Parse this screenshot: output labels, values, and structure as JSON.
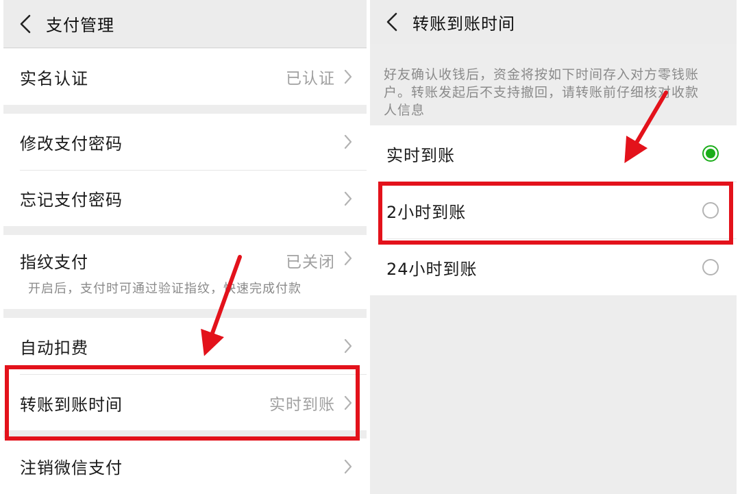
{
  "left": {
    "title": "支付管理",
    "rows": [
      {
        "label": "实名认证",
        "value": "已认证"
      },
      {
        "label": "修改支付密码",
        "value": ""
      },
      {
        "label": "忘记支付密码",
        "value": ""
      },
      {
        "label": "指纹支付",
        "value": "已关闭",
        "sub": "开启后，支付时可通过验证指纹，快速完成付款"
      },
      {
        "label": "自动扣费",
        "value": ""
      },
      {
        "label": "转账到账时间",
        "value": "实时到账"
      },
      {
        "label": "注销微信支付",
        "value": ""
      }
    ]
  },
  "right": {
    "title": "转账到账时间",
    "description": "好友确认收钱后，资金将按如下时间存入对方零钱账户。转账发起后不支持撤回，请转账前仔细核对收款人信息",
    "options": [
      {
        "label": "实时到账",
        "selected": true
      },
      {
        "label": "2小时到账",
        "selected": false
      },
      {
        "label": "24小时到账",
        "selected": false
      }
    ]
  },
  "colors": {
    "accent_green": "#1aad19",
    "highlight_red": "#e3121b"
  },
  "icons": [
    "back-arrow-icon",
    "chevron-right-icon",
    "radio-selected-icon",
    "radio-unselected-icon",
    "annotation-arrow-icon"
  ]
}
